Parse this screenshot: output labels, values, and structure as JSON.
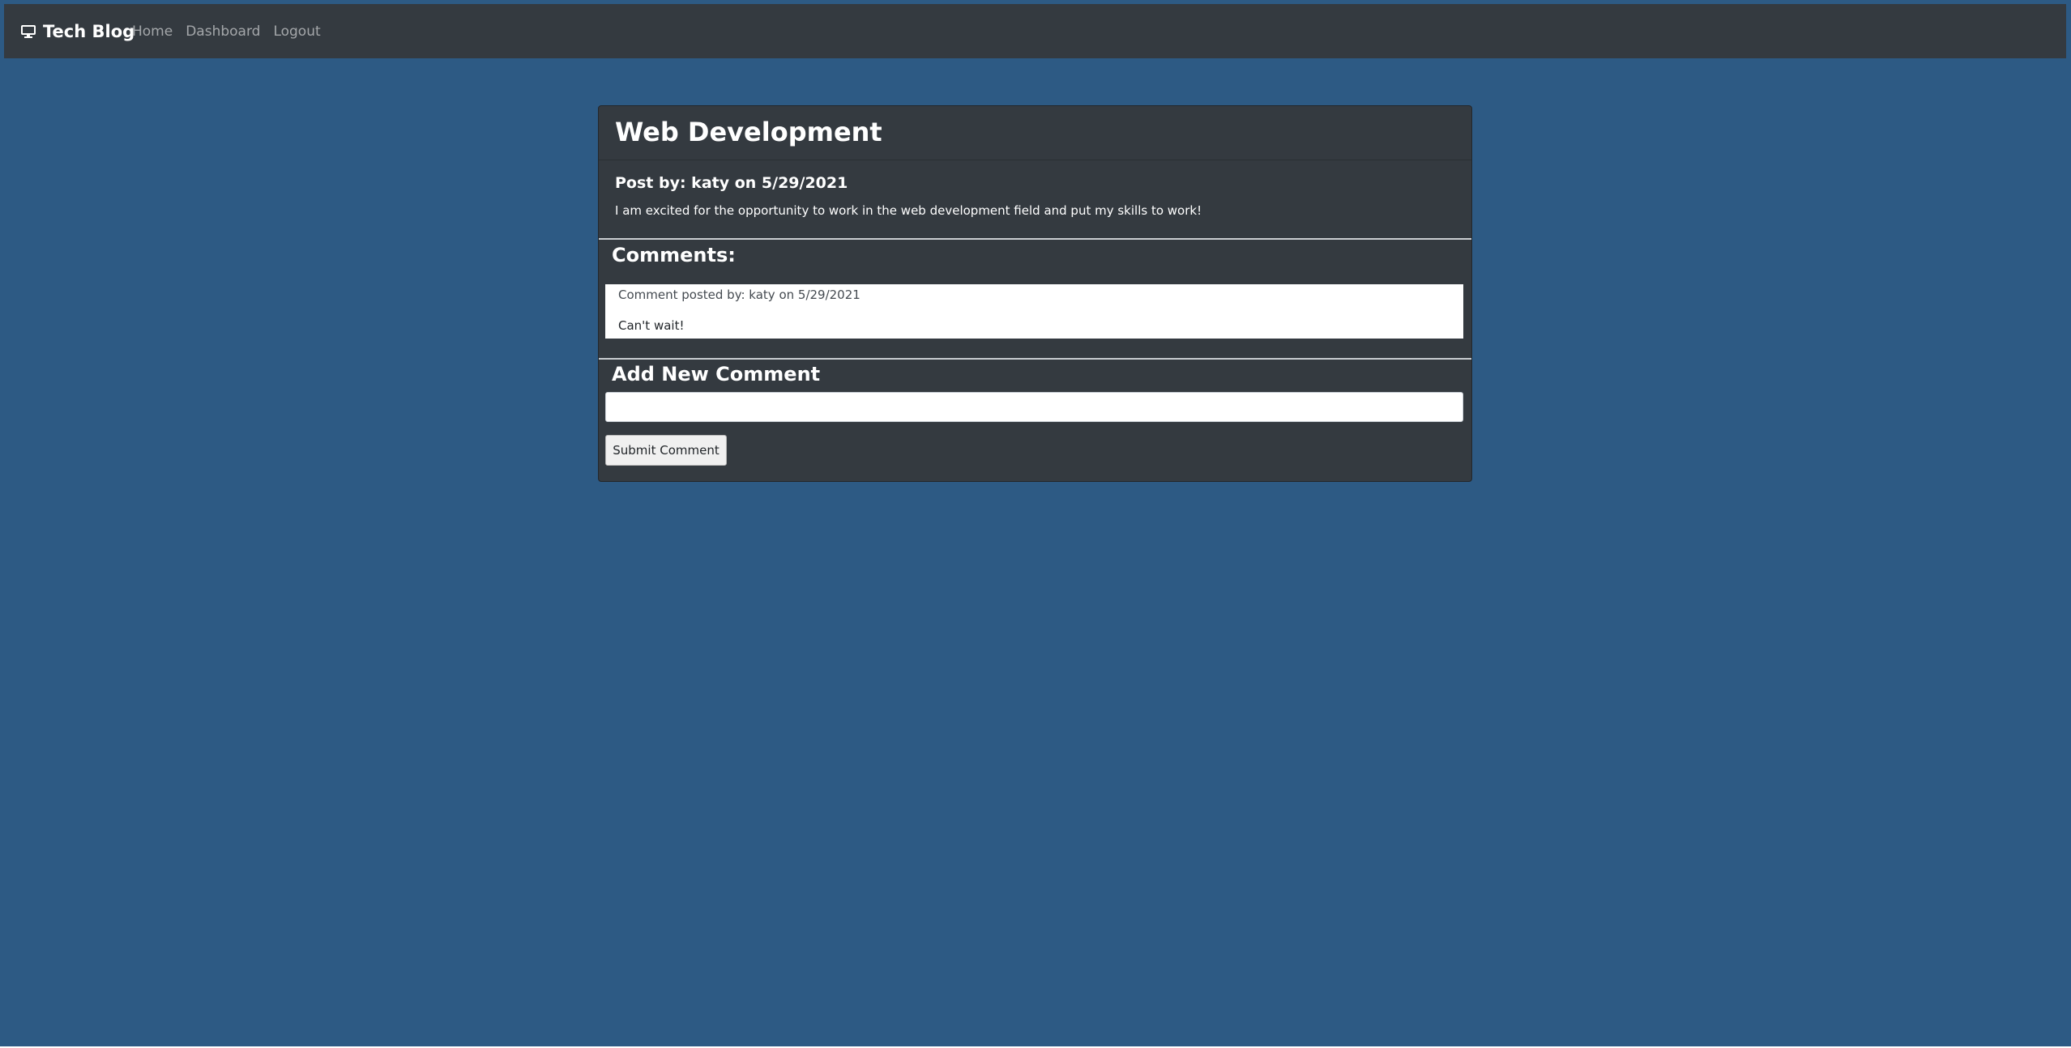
{
  "nav": {
    "brand": "Tech Blog",
    "brand_icon": "desktop-icon",
    "links": [
      "Home",
      "Dashboard",
      "Logout"
    ]
  },
  "post": {
    "title": "Web Development",
    "meta": "Post by: katy on 5/29/2021",
    "body": "I am excited for the opportunity to work in the web development field and put my skills to work!"
  },
  "comments": {
    "heading": "Comments:",
    "items": [
      {
        "meta": "Comment posted by: katy on 5/29/2021",
        "text": "Can't wait!"
      }
    ]
  },
  "new_comment": {
    "heading": "Add New Comment",
    "value": "",
    "submit_label": "Submit Comment"
  },
  "colors": {
    "page_background": "#2d5a84",
    "navbar": "#343a40",
    "card": "#343a40",
    "comment_background": "#ffffff"
  }
}
